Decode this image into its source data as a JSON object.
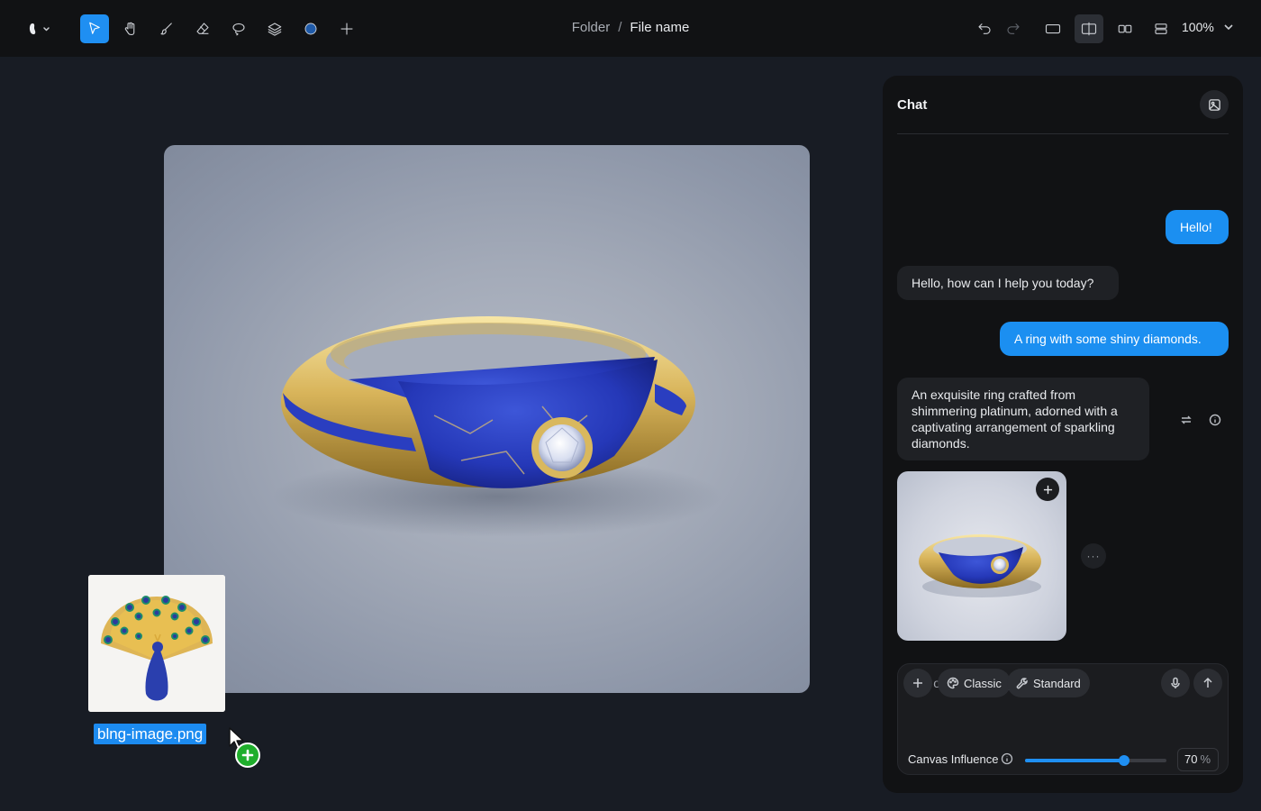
{
  "toolbar": {
    "logo_icon": "app-logo-icon",
    "tools": [
      "select-tool",
      "hand-tool",
      "brush-tool",
      "eraser-tool",
      "lasso-tool",
      "layers-tool",
      "color-swatch",
      "add-tool"
    ],
    "active_tool": "select-tool",
    "color_swatch": "#1f5aa8",
    "accent": "#1f8ff2"
  },
  "breadcrumb": {
    "folder": "Folder",
    "separator": "/",
    "file": "File name"
  },
  "view": {
    "zoom": "100%",
    "layouts": [
      "single-view",
      "split-view",
      "compare-view",
      "stack-view"
    ],
    "active_layout": "split-view"
  },
  "canvas": {
    "main_image": "gold-ring-with-lapis-and-diamond",
    "dragged_file": "blng-image.png",
    "dragged_image": "peacock-brooch"
  },
  "chat": {
    "title": "Chat",
    "messages": [
      {
        "role": "user",
        "text": "Hello!"
      },
      {
        "role": "assistant",
        "text": "Hello, how can I help you today?"
      },
      {
        "role": "user",
        "text": "A ring with some shiny diamonds."
      },
      {
        "role": "assistant",
        "text": "An exquisite ring crafted from shimmering platinum, adorned with a captivating arrangement of sparkling diamonds."
      }
    ],
    "more_label": "···",
    "composer": {
      "placeholder": "Ask or request anything...",
      "style_label": "Classic",
      "quality_label": "Standard"
    },
    "influence": {
      "label": "Canvas Influence",
      "value": 70,
      "unit": "%"
    }
  }
}
